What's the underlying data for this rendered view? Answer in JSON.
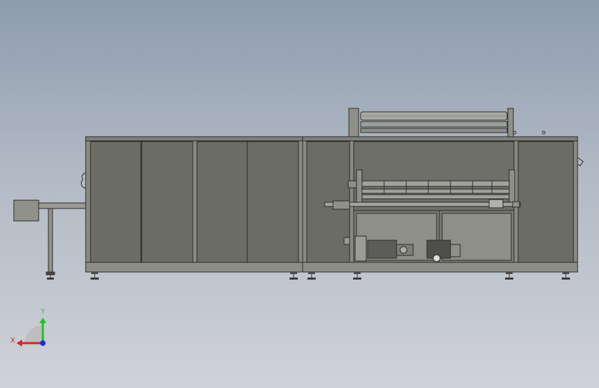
{
  "triad": {
    "x_label": "X",
    "y_label": "Y",
    "colors": {
      "x": "#e0201c",
      "y": "#1fbf2a",
      "z": "#1c2fe0"
    }
  },
  "colors": {
    "background_top": "#8e9cae",
    "background_bottom": "#cfd2d8",
    "panel": "#6b6c64",
    "frame": "#8a8a80"
  }
}
